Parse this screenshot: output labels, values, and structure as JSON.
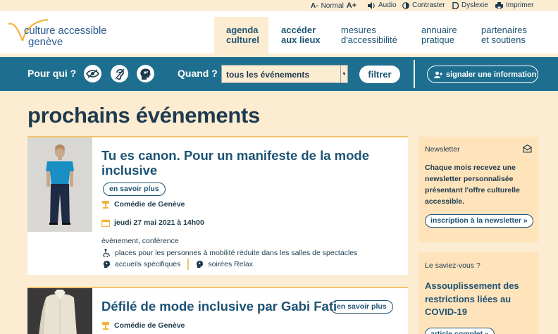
{
  "utility": {
    "size_minus": "A-",
    "size_normal": "Normal",
    "size_plus": "A+",
    "audio": "Audio",
    "contrast": "Contraster",
    "dyslexia": "Dyslexie",
    "print": "Imprimer"
  },
  "logo": {
    "line1": "culture accessible",
    "line2": "genève"
  },
  "nav": [
    {
      "line1": "agenda",
      "line2": "culturel"
    },
    {
      "line1": "accéder",
      "line2": "aux lieux"
    },
    {
      "line1": "mesures",
      "line2": "d'accessibilité"
    },
    {
      "line1": "annuaire",
      "line2": "pratique"
    },
    {
      "line1": "partenaires",
      "line2": "et soutiens"
    }
  ],
  "filter": {
    "pour_qui": "Pour qui ?",
    "quand": "Quand ?",
    "select_value": "tous les événements",
    "filter_button": "filtrer",
    "signal_button": "signaler une information"
  },
  "page_title": "prochains événements",
  "events": [
    {
      "title_line1": "Tu es canon. Pour un manifeste de la mode",
      "title_line2": "inclusive",
      "more": "en savoir plus",
      "venue": "Comédie de Genève",
      "date": "jeudi 27 mai 2021 à 14h00",
      "categories": "évènement, conférence",
      "access_mobility": "places pour les personnes à mobilité réduite dans les salles de spectacles",
      "access_welcome": "accueils spécifiques",
      "access_relax": "soirées Relax"
    },
    {
      "title": "Défilé de mode inclusive par Gabi Fati",
      "more": "en savoir plus",
      "venue": "Comédie de Genève"
    }
  ],
  "sidebar": {
    "newsletter_heading": "Newsletter",
    "newsletter_text": "Chaque mois recevez une newsletter personnalisée présentant l'offre culturelle accessible.",
    "newsletter_button": "inscription à la newsletter »",
    "info_heading": "Le saviez-vous ?",
    "info_title": "Assouplissement des restrictions liées au COVID-19",
    "info_button": "article complet »"
  },
  "colors": {
    "background": "#fcecd2",
    "filter_bar": "#1e6f8f",
    "accent": "#f3c36a",
    "text_dark": "#1d3a4e",
    "link_blue": "#1d5374"
  },
  "icons": [
    "volume-icon",
    "contrast-icon",
    "dyslexia-icon",
    "print-icon",
    "eye-icon",
    "ear-icon",
    "head-icon",
    "user-plus-icon",
    "theater-icon",
    "calendar-icon",
    "wheelchair-icon",
    "mail-icon"
  ]
}
